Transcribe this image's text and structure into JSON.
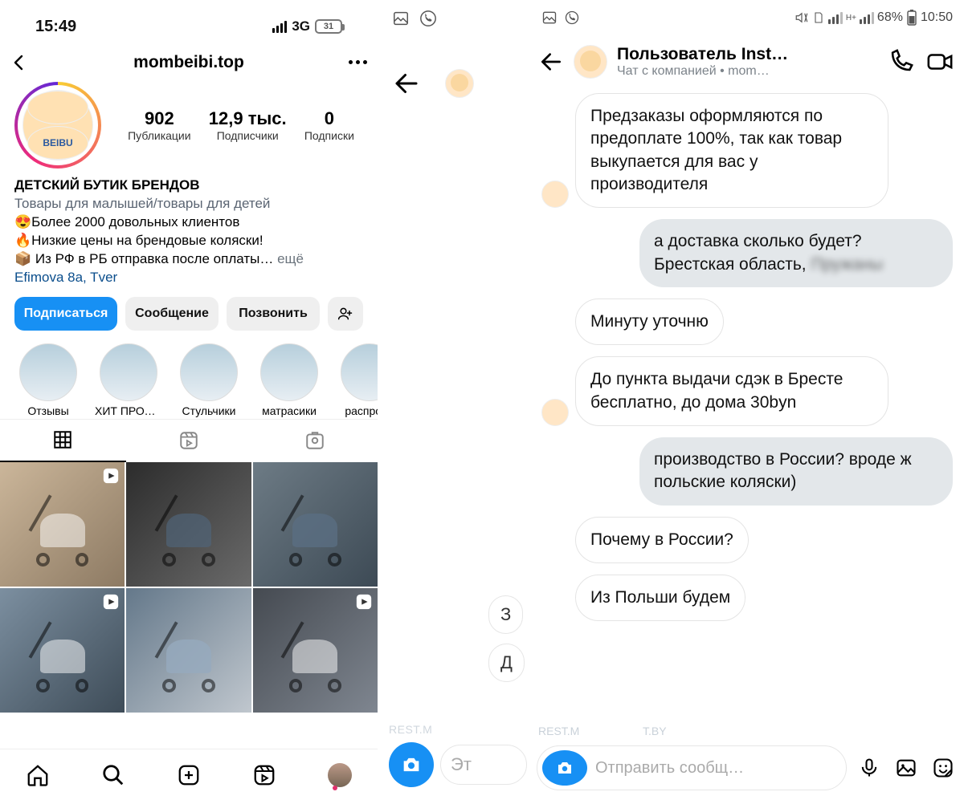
{
  "left": {
    "status": {
      "time": "15:49",
      "net": "3G",
      "battery": "31"
    },
    "header": {
      "username": "mombeibi.top"
    },
    "avatar_label": "BEIBU",
    "stats": {
      "posts_num": "902",
      "posts_lbl": "Публикации",
      "followers_num": "12,9 тыс.",
      "followers_lbl": "Подписчики",
      "following_num": "0",
      "following_lbl": "Подписки"
    },
    "bio": {
      "name": "ДЕТСКИЙ БУТИК БРЕНДОВ",
      "category": "Товары для малышей/товары для детей",
      "line1": "😍Более 2000 довольных клиентов",
      "line2": "🔥Низкие цены на брендовые коляски!",
      "line3": "📦 Из РФ в РБ отправка после оплаты…",
      "more": "ещё",
      "address": "Efimova 8a, Tver"
    },
    "buttons": {
      "follow": "Подписаться",
      "message": "Сообщение",
      "call": "Позвонить"
    },
    "highlights": [
      "Отзывы",
      "ХИТ ПРОД…",
      "Стульчики",
      "матрасики",
      "распрода"
    ]
  },
  "mid": {
    "peek1": "З",
    "peek2": "Д",
    "placeholder": "Эт",
    "watermark": "REST.M"
  },
  "right": {
    "status": {
      "battery": "68%",
      "time": "10:50"
    },
    "header": {
      "title": "Пользователь Inst…",
      "sub": "Чат с компанией • mom…"
    },
    "messages": {
      "m1": "Предзаказы оформляются по предоплате 100%, так как товар выкупается для вас у производителя",
      "m2a": "а доставка сколько будет? Брестская область,",
      "m2b": "Пружаны",
      "m3": "Минуту уточню",
      "m4": "До пункта выдачи сдэк в Бресте бесплатно, до дома 30byn",
      "m5": "производство в России? вроде ж польские коляски)",
      "m6": "Почему в России?",
      "m7": "Из Польши будем"
    },
    "input_placeholder": "Отправить сообщ…",
    "watermark1": "REST.M",
    "watermark2": "T.BY"
  }
}
